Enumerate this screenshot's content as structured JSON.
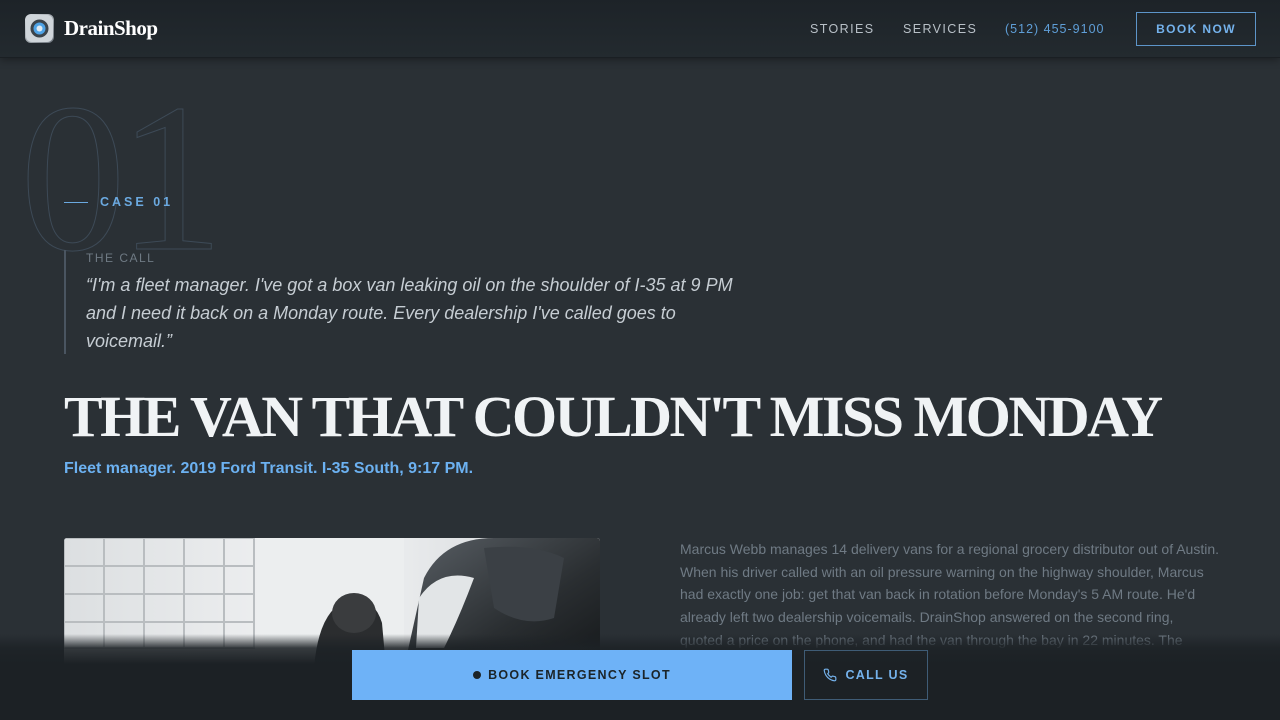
{
  "brand": {
    "name": "DrainShop"
  },
  "nav": {
    "stories": "STORIES",
    "services": "SERVICES",
    "phone": "(512) 455-9100",
    "book": "BOOK NOW"
  },
  "case": {
    "number": "01",
    "label": "CASE 01",
    "call_label": "THE CALL",
    "quote": "“I'm a fleet manager. I've got a box van leaking oil on the shoulder of I-35 at 9 PM and I need it back on a Monday route. Every dealership I've called goes to voicemail.”",
    "headline": "THE VAN THAT COULDN'T MISS MONDAY",
    "subline": "Fleet manager. 2019 Ford Transit. I-35 South, 9:17 PM.",
    "story": "Marcus Webb manages 14 delivery vans for a regional grocery distributor out of Austin. When his driver called with an oil pressure warning on the highway shoulder, Marcus had exactly one job: get that van back in rotation before Monday's 5 AM route. He'd already left two dealership voicemails. DrainShop answered on the second ring, quoted a price on the phone, and had the van through the bay in 22 minutes. The"
  },
  "cta": {
    "emergency": "BOOK EMERGENCY SLOT",
    "call": "CALL US"
  },
  "colors": {
    "accent": "#6eb2f7",
    "link_blue": "#6cb1f1",
    "background": "#2a3035",
    "nav_bg": "#1d2328"
  },
  "icons": [
    "logo-icon",
    "phone-icon",
    "status-dot-icon"
  ]
}
